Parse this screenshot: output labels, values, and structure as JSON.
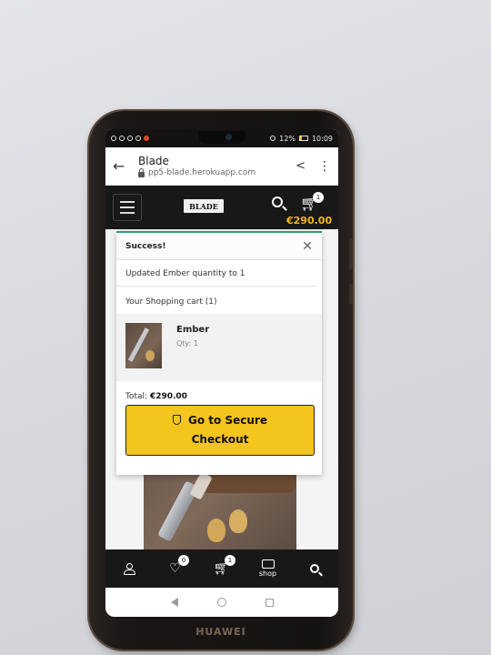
{
  "status_bar": {
    "battery": "12%",
    "time": "10:09"
  },
  "browser": {
    "title": "Blade",
    "url": "pp5-blade.herokuapp.com"
  },
  "site_header": {
    "logo_text": "BLADE",
    "cart_count": "1",
    "cart_total": "€290.00"
  },
  "toast": {
    "title": "Success!",
    "message": "Updated Ember quantity to 1",
    "cart_heading": "Your Shopping cart (1)",
    "item": {
      "name": "Ember",
      "qty": "Qty: 1"
    },
    "total_label": "Total:",
    "total_value": "€290.00",
    "checkout_line1": "Go to Secure",
    "checkout_line2": "Checkout"
  },
  "bottom_nav": {
    "wishlist_count": "0",
    "cart_count": "1",
    "shop_label": "shop"
  },
  "device": {
    "brand": "HUAWEI"
  },
  "colors": {
    "accent": "#f4c51d",
    "header_bg": "#181818",
    "success": "#2f9e6f",
    "price": "#f3b51d"
  }
}
